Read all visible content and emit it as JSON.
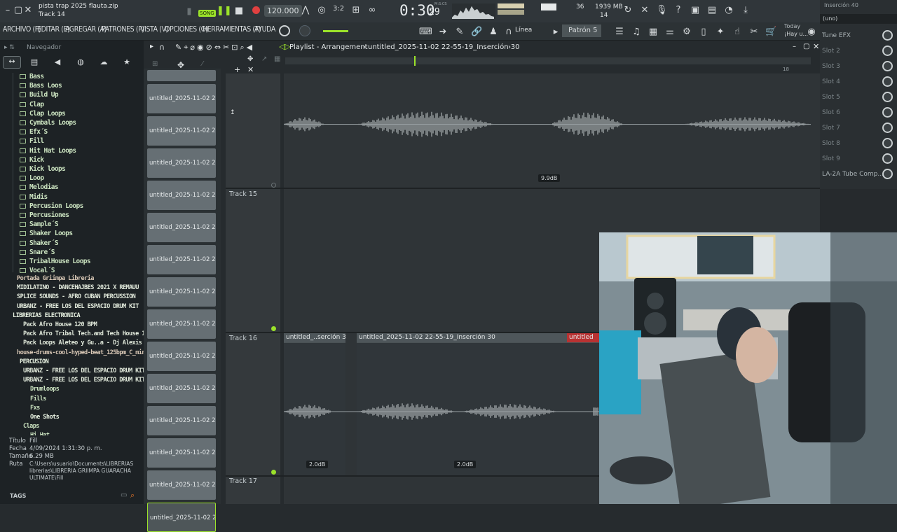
{
  "window": {
    "file_title": "pista trap 2025 flauta.zip",
    "track_name": "Track 14",
    "song_mode": "SONG",
    "tempo": "120.000",
    "time": "0:30",
    "time_frac": "29",
    "time_label": "M:S:CS",
    "cpu_top": "36",
    "cpu_bottom": "14",
    "memory": "1939 MB",
    "line_mode": "Línea",
    "pattern": "Patrón 5",
    "news_today": "Today",
    "news_text": "¡Hay u..."
  },
  "menu": [
    "ARCHIVO (F)",
    "EDITAR (E)",
    "AGREGAR (A)",
    "PATRONES (P)",
    "VISTA (V)",
    "OPCIONES (O)",
    "HERRAMIENTAS (T)",
    "AYUDA"
  ],
  "browser": {
    "title": "Navegador",
    "folders": [
      "Bass",
      "Bass Loos",
      "Build Up",
      "Clap",
      "Clap Loops",
      "Cymbals Loops",
      "Efx´S",
      "Fill",
      "Hit Hat Loops",
      "Kick",
      "Kick loops",
      "Loop",
      "Melodias",
      "Midis",
      "Percusion Loops",
      "Percusiones",
      "Sample´S",
      "Shaker Loops",
      "Shaker´S",
      "Snare´S",
      "TribalHouse Loops",
      "Vocal´S"
    ],
    "libraries": [
      "Portada Griimpa Libreria",
      "MIDILATINO - DANCEHAJBES 2021 X REMAUU",
      "SPLICE SOUNDS - AFRO CUBAN PERCUSSION",
      "URBANZ - FREE LOS DEL ESPACIO DRUM KIT",
      "LIBRERIAS ELECTRONICA",
      "Pack Afro House 120 BPM",
      "Pack Afro Tribal Tech.and Tech House 126BPM",
      "Pack Loops Aleteo y Gu..a - Dj Alexis Delgado",
      "house-drums-cool-hyped-beat_125bpm_C_minor",
      "PERCUSION",
      "URBANZ - FREE LOS DEL ESPACIO DRUM KIT",
      "URBANZ - FREE LOS DEL ESPACIO DRUM KIT",
      "Drumloops",
      "Fills",
      "Fxs",
      "One Shots",
      "Claps",
      "Hi Hat"
    ],
    "info": {
      "titulo_label": "Título",
      "titulo": "Fill",
      "fecha_label": "Fecha",
      "fecha": "4/09/2024 1:31:30 p. m.",
      "tamano_label": "Tamaño",
      "tamano": "6.29 MB",
      "ruta_label": "Ruta",
      "ruta": "C:\\Users\\usuario\\Documents\\LIBRERIAS librerias\\LIBRERIA GRIIMPA GUARACHA ULTIMATE\\Fill"
    },
    "tags": "TAGS"
  },
  "playlist": {
    "title": "Playlist - Arrangement",
    "pattern_name": "untitled_2025-11-02 22-55-19_Inserción 30",
    "ruler_mark": "18",
    "tracks": [
      "Track 15",
      "Track 16",
      "Track 17"
    ],
    "clip_labels": [
      "untitled_2025-11-02 22-..."
    ],
    "top_db": "9.9dB",
    "t16_clips": [
      "untitled_..serción 30",
      "untitled_2025-11-02 22-55-19_Inserción 30",
      "untitled"
    ],
    "t16_db": [
      "2.0dB",
      "2.0dB"
    ]
  },
  "mixer": {
    "title": "Inserción 40",
    "preset": "(uno)",
    "slots": [
      "Tune EFX",
      "Slot 2",
      "Slot 3",
      "Slot 4",
      "Slot 5",
      "Slot 6",
      "Slot 7",
      "Slot 8",
      "Slot 9",
      "LA-2A Tube Comp..."
    ]
  },
  "colors": {
    "accent_green": "#9be22a",
    "record_red": "#e04040",
    "clip_grey": "#666f74"
  }
}
